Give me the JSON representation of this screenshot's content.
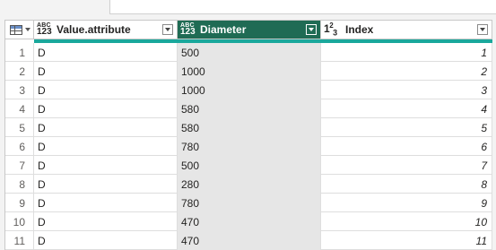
{
  "columns": [
    {
      "type_top": "ABC",
      "type_bottom": "123",
      "label": "Value.attribute"
    },
    {
      "type_top": "ABC",
      "type_bottom": "123",
      "label": "Diameter"
    },
    {
      "type_top": "1",
      "type_sub": "2",
      "type_after": "3",
      "label": "Index"
    }
  ],
  "colors": {
    "selected_header": "#1f6b54",
    "quality_bar": "#1aa89c",
    "selected_column": "#e6e6e6"
  },
  "rows": [
    {
      "n": "1",
      "attr": "D",
      "diameter": "500",
      "index": "1"
    },
    {
      "n": "2",
      "attr": "D",
      "diameter": "1000",
      "index": "2"
    },
    {
      "n": "3",
      "attr": "D",
      "diameter": "1000",
      "index": "3"
    },
    {
      "n": "4",
      "attr": "D",
      "diameter": "580",
      "index": "4"
    },
    {
      "n": "5",
      "attr": "D",
      "diameter": "580",
      "index": "5"
    },
    {
      "n": "6",
      "attr": "D",
      "diameter": "780",
      "index": "6"
    },
    {
      "n": "7",
      "attr": "D",
      "diameter": "500",
      "index": "7"
    },
    {
      "n": "8",
      "attr": "D",
      "diameter": "280",
      "index": "8"
    },
    {
      "n": "9",
      "attr": "D",
      "diameter": "780",
      "index": "9"
    },
    {
      "n": "10",
      "attr": "D",
      "diameter": "470",
      "index": "10"
    },
    {
      "n": "11",
      "attr": "D",
      "diameter": "470",
      "index": "11"
    }
  ]
}
